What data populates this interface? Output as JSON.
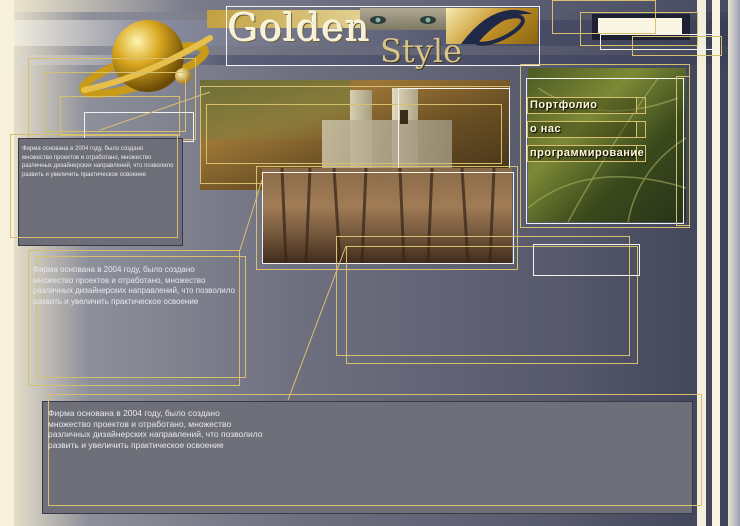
{
  "header": {
    "logo_word1": "Golden",
    "logo_word2": "Style"
  },
  "menu": {
    "items": [
      {
        "label": "Портфолио"
      },
      {
        "label": "о нас"
      },
      {
        "label": "программирование"
      }
    ]
  },
  "content": {
    "paragraph_small": "Фирма основана в 2004 году, было создано\n множество проектов и отработано, множество\n различных дизайнерских направлений, что позволило\nразвить и увеличить практическое освоение",
    "paragraph_mid": "Фирма основана в 2004 году, было создано\n множество проектов и отработано, множество\n различных дизайнерских направлений, что позволило\nразвить и увеличить практическое освоение",
    "paragraph_bottom": "Фирма основана в 2004 году, было создано\n множество проектов и отработано, множество\n различных дизайнерских направлений, что позволило\nразвить и увеличить практическое освоение"
  },
  "colors": {
    "accent_gold": "#d6c070",
    "panel": "#6f6f79"
  }
}
